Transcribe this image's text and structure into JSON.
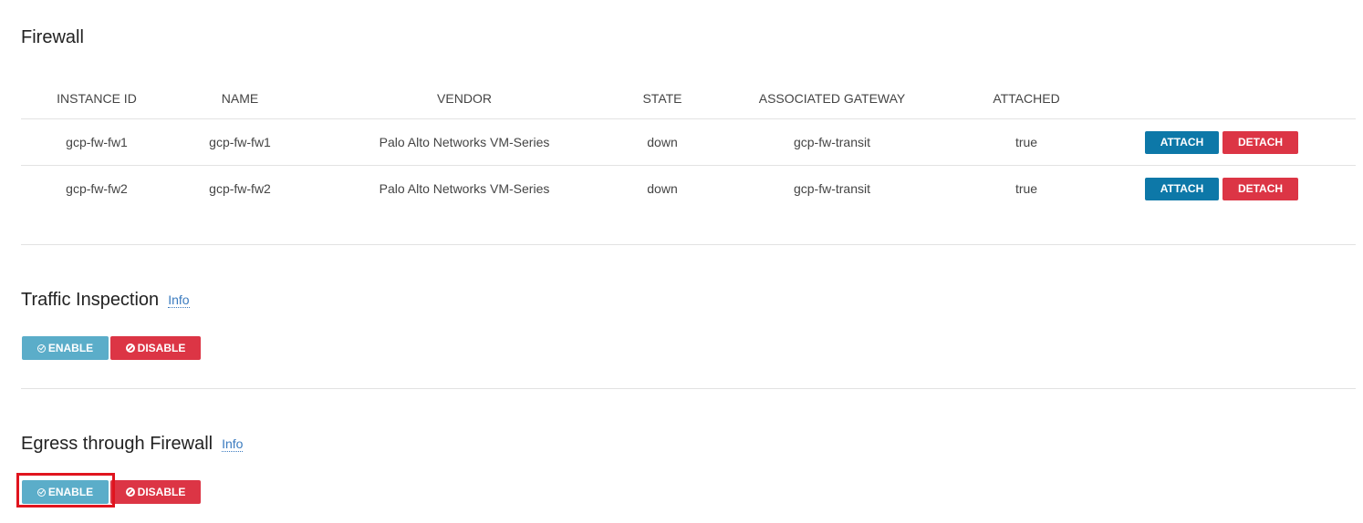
{
  "firewall": {
    "title": "Firewall",
    "columns": [
      "INSTANCE ID",
      "NAME",
      "VENDOR",
      "STATE",
      "ASSOCIATED GATEWAY",
      "ATTACHED"
    ],
    "rows": [
      {
        "instance_id": "gcp-fw-fw1",
        "name": "gcp-fw-fw1",
        "vendor": "Palo Alto Networks VM-Series",
        "state": "down",
        "gateway": "gcp-fw-transit",
        "attached": "true",
        "attach_label": "ATTACH",
        "detach_label": "DETACH"
      },
      {
        "instance_id": "gcp-fw-fw2",
        "name": "gcp-fw-fw2",
        "vendor": "Palo Alto Networks VM-Series",
        "state": "down",
        "gateway": "gcp-fw-transit",
        "attached": "true",
        "attach_label": "ATTACH",
        "detach_label": "DETACH"
      }
    ]
  },
  "traffic_inspection": {
    "title": "Traffic Inspection",
    "info_label": "Info",
    "enable_label": "ENABLE",
    "disable_label": "DISABLE"
  },
  "egress": {
    "title": "Egress through Firewall",
    "info_label": "Info",
    "enable_label": "ENABLE",
    "disable_label": "DISABLE"
  },
  "icons": {
    "enable": "check-circle-icon",
    "disable": "ban-icon"
  },
  "colors": {
    "attach": "#0d78a8",
    "detach": "#dc3545",
    "enable": "#5badc9",
    "disable": "#dc3545",
    "info_link": "#3b7bbf",
    "highlight": "#e0141e"
  }
}
